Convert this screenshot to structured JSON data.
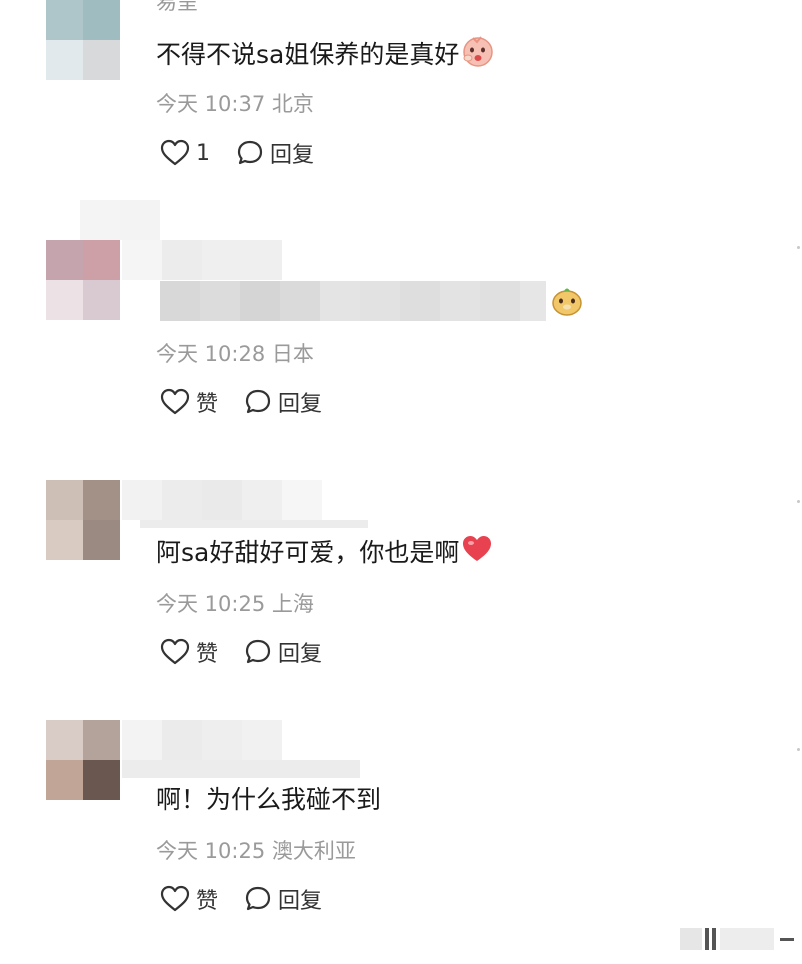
{
  "comments": [
    {
      "username_partial": "易呈",
      "text": "不得不说sa姐保养的是真好",
      "time": "今天 10:37",
      "location": "北京",
      "like_label": "1",
      "reply_label": "回复",
      "emoji": "shy-face-emoji"
    },
    {
      "text": "",
      "time": "今天 10:28",
      "location": "日本",
      "like_label": "赞",
      "reply_label": "回复",
      "emoji": "cute-bear-emoji"
    },
    {
      "text": "阿sa好甜好可爱，你也是啊",
      "time": "今天 10:25",
      "location": "上海",
      "like_label": "赞",
      "reply_label": "回复",
      "emoji": "red-heart-emoji"
    },
    {
      "text": "啊！为什么我碰不到",
      "time": "今天 10:25",
      "location": "澳大利亚",
      "like_label": "赞",
      "reply_label": "回复"
    }
  ],
  "icons": {
    "like": "heart-outline-icon",
    "reply": "speech-bubble-icon"
  },
  "colors": {
    "text": "#1a1a1a",
    "meta": "#9a9a9a",
    "heart_emoji": "#e8414f"
  }
}
